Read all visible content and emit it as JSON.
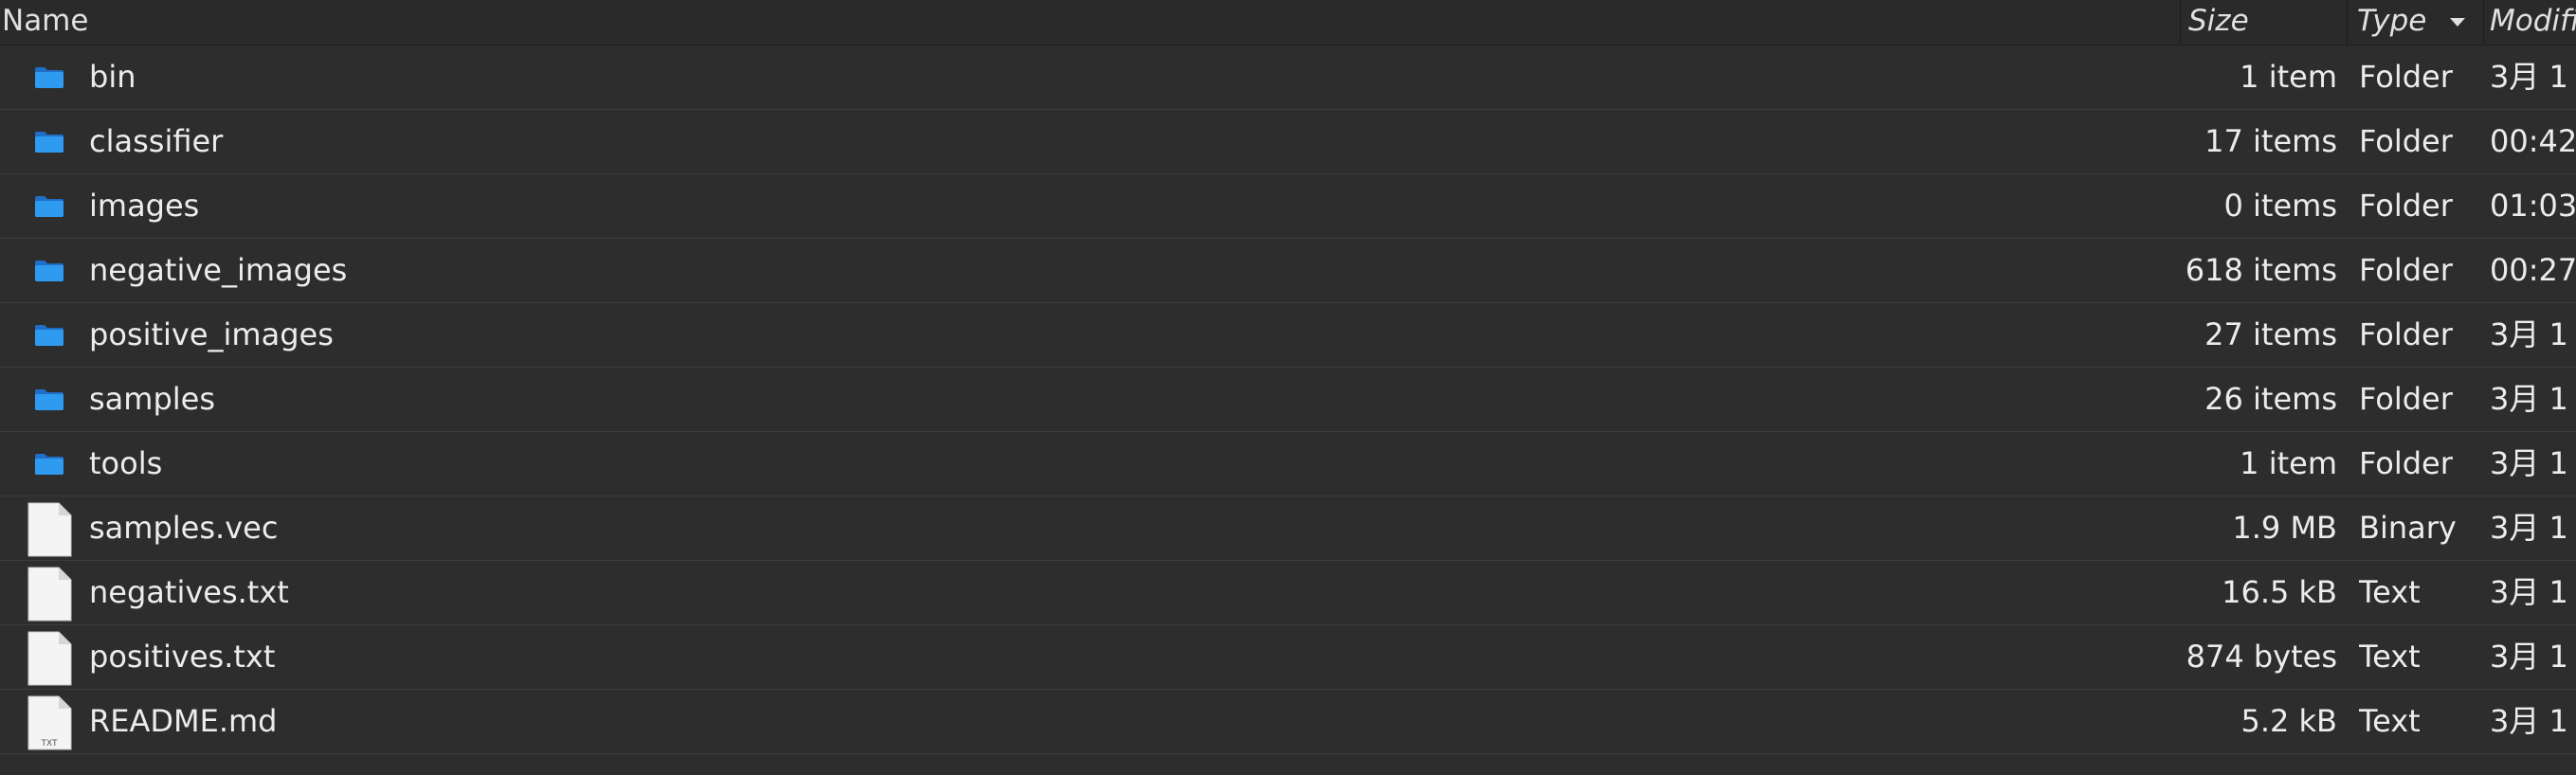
{
  "header": {
    "name": "Name",
    "size": "Size",
    "type": "Type",
    "modified": "Modifi"
  },
  "files": [
    {
      "name": "bin",
      "size": "1 item",
      "type": "Folder",
      "modified": "3月 1",
      "icon": "folder-icon"
    },
    {
      "name": "classifier",
      "size": "17 items",
      "type": "Folder",
      "modified": "00:42",
      "icon": "folder-icon"
    },
    {
      "name": "images",
      "size": "0 items",
      "type": "Folder",
      "modified": "01:03",
      "icon": "folder-icon"
    },
    {
      "name": "negative_images",
      "size": "618 items",
      "type": "Folder",
      "modified": "00:27",
      "icon": "folder-icon"
    },
    {
      "name": "positive_images",
      "size": "27 items",
      "type": "Folder",
      "modified": "3月 1",
      "icon": "folder-icon"
    },
    {
      "name": "samples",
      "size": "26 items",
      "type": "Folder",
      "modified": "3月 1",
      "icon": "folder-icon"
    },
    {
      "name": "tools",
      "size": "1 item",
      "type": "Folder",
      "modified": "3月 1",
      "icon": "folder-icon"
    },
    {
      "name": "samples.vec",
      "size": "1.9 MB",
      "type": "Binary",
      "modified": "3月 1",
      "icon": "file-icon"
    },
    {
      "name": "negatives.txt",
      "size": "16.5 kB",
      "type": "Text",
      "modified": "3月 1",
      "icon": "file-icon"
    },
    {
      "name": "positives.txt",
      "size": "874 bytes",
      "type": "Text",
      "modified": "3月 1",
      "icon": "file-icon"
    },
    {
      "name": "README.md",
      "size": "5.2 kB",
      "type": "Text",
      "modified": "3月 1",
      "icon": "text-file-icon",
      "icon_label": "TXT"
    }
  ],
  "colors": {
    "background": "#2d2d2d",
    "folder": "#2f9bf0",
    "text": "#ececec"
  }
}
